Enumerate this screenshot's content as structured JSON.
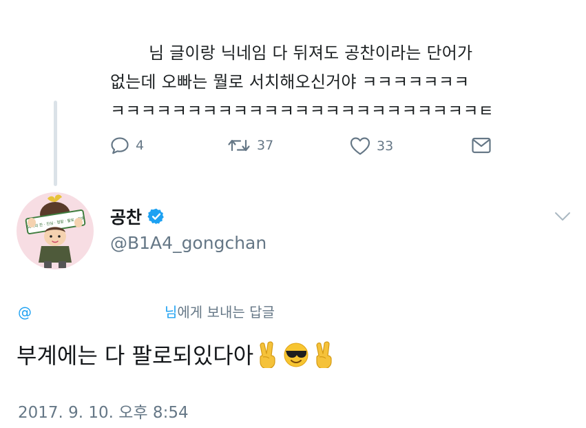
{
  "previous_tweet": {
    "lines": [
      "님 글이랑 닉네임 다 뒤져도 공찬이라는 단어가",
      "없는데 오빠는 뭘로 서치해오신거야 ㅋㅋㅋㅋㅋㅋㅋ",
      "ㅋㅋㅋㅋㅋㅋㅋㅋㅋㅋㅋㅋㅋㅋㅋㅋㅋㅋㅋㅋㅋㅋㅋㅋㅌ"
    ],
    "actions": {
      "reply_icon": "reply-icon",
      "reply_count": "4",
      "retweet_icon": "retweet-icon",
      "retweet_count": "37",
      "like_icon": "heart-icon",
      "like_count": "33",
      "dm_icon": "envelope-icon"
    }
  },
  "author": {
    "display_name": "공찬",
    "verified": true,
    "handle": "@B1A4_gongchan",
    "avatar_icon": "avatar-cartoon",
    "banner_text": "66사의 찬 · 진심 · 정말 · 팔로 · 찬희"
  },
  "reply_context": {
    "at_symbol": "@",
    "partial_name": "님",
    "suffix": "에게 보내는 답글"
  },
  "tweet": {
    "text": "부계에는 다 팔로되있다아",
    "emojis": [
      "victory-hand",
      "smiling-face-with-sunglasses",
      "victory-hand"
    ]
  },
  "timestamp": "2017. 9. 10. 오후 8:54",
  "colors": {
    "accent": "#1da1f2",
    "muted": "#657786",
    "thread_line": "#dbe2e8",
    "avatar_bg": "#f7dde3"
  }
}
